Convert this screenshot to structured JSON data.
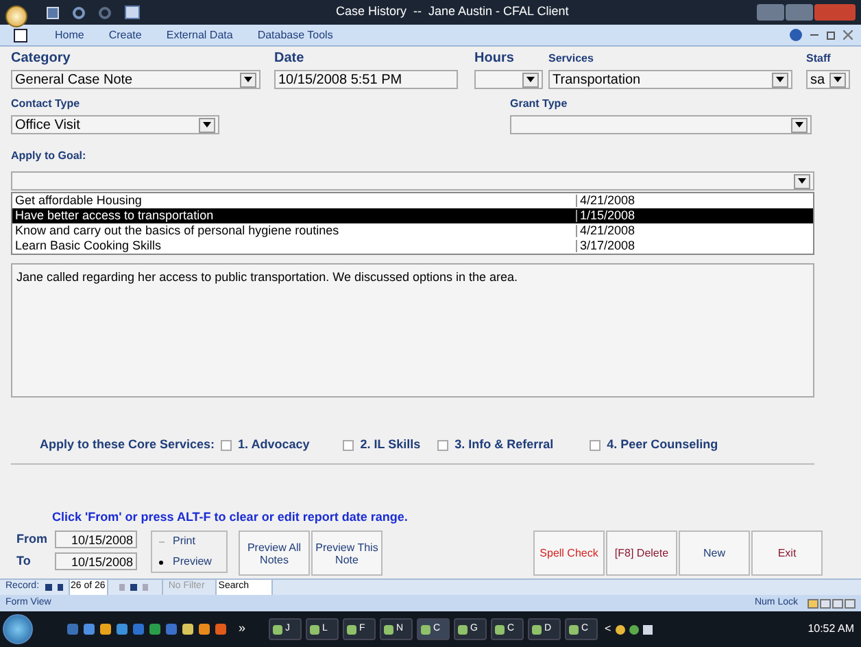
{
  "window": {
    "title": "Case History  --  Jane Austin - CFAL Client"
  },
  "ribbon_tabs": [
    "Home",
    "Create",
    "External Data",
    "Database Tools"
  ],
  "fields_row1": [
    {
      "label": "Category",
      "value": "General Case Note",
      "kind": "dropdown"
    },
    {
      "label": "Date",
      "value": "10/15/2008 5:51 PM",
      "kind": "text"
    },
    {
      "label": "Hours",
      "kind": "dropdown"
    },
    {
      "label": "Services",
      "value": "Transportation",
      "kind": "dropdown"
    },
    {
      "label": "Staff",
      "value": "sa",
      "kind": "dropdown"
    }
  ],
  "contact_type": {
    "label": "Contact Type",
    "value": "Office Visit"
  },
  "grant_type": {
    "label": "Grant Type"
  },
  "goal": {
    "label": "Apply to Goal:",
    "rows": [
      {
        "goal": "Get affordable Housing",
        "date": "4/21/2008",
        "selected": false
      },
      {
        "goal": "Have better access to transportation",
        "date": "1/15/2008",
        "selected": true
      },
      {
        "goal": "Know and carry out the basics of personal hygiene routines",
        "date": "4/21/2008",
        "selected": false
      },
      {
        "goal": "Learn Basic Cooking Skills",
        "date": "3/17/2008",
        "selected": false
      }
    ]
  },
  "note": "Jane called regarding her access to public transportation. We discussed options in the area.",
  "core_services": {
    "label": "Apply to these Core Services:",
    "items": [
      {
        "label": "1. Advocacy",
        "checked": false
      },
      {
        "label": "2. IL Skills",
        "checked": false
      },
      {
        "label": "3. Info & Referral",
        "checked": false
      },
      {
        "label": "4. Peer Counseling",
        "checked": false
      }
    ]
  },
  "instruction": "Click 'From' or press ALT-F to clear or edit report date range.",
  "date_range": [
    {
      "label": "From",
      "value": "10/15/2008"
    },
    {
      "label": "To",
      "value": "10/15/2008"
    }
  ],
  "output_options": [
    {
      "label": "Print",
      "selected": false
    },
    {
      "label": "Preview",
      "selected": true
    }
  ],
  "buttons": [
    {
      "label": "Preview All Notes",
      "kind": "plain"
    },
    {
      "label": "Preview This Note",
      "kind": "plain"
    },
    {
      "label": "Spell Check",
      "kind": "red"
    },
    {
      "label": "[F8] Delete",
      "kind": "maroon"
    },
    {
      "label": "New",
      "kind": "plain"
    },
    {
      "label": "Exit",
      "kind": "maroon"
    }
  ],
  "record_nav": {
    "label": "Record:",
    "position": "26 of 26",
    "filter": "No Filter",
    "search": "Search"
  },
  "status_bar": {
    "view": "Form View",
    "indicator": "Num Lock"
  },
  "taskbar": {
    "chevron": "»",
    "windows": [
      "J",
      "L",
      "F",
      "N",
      "C",
      "G",
      "C",
      "D",
      "C"
    ],
    "tray_chevron": "<",
    "clock": "10:52 AM"
  }
}
